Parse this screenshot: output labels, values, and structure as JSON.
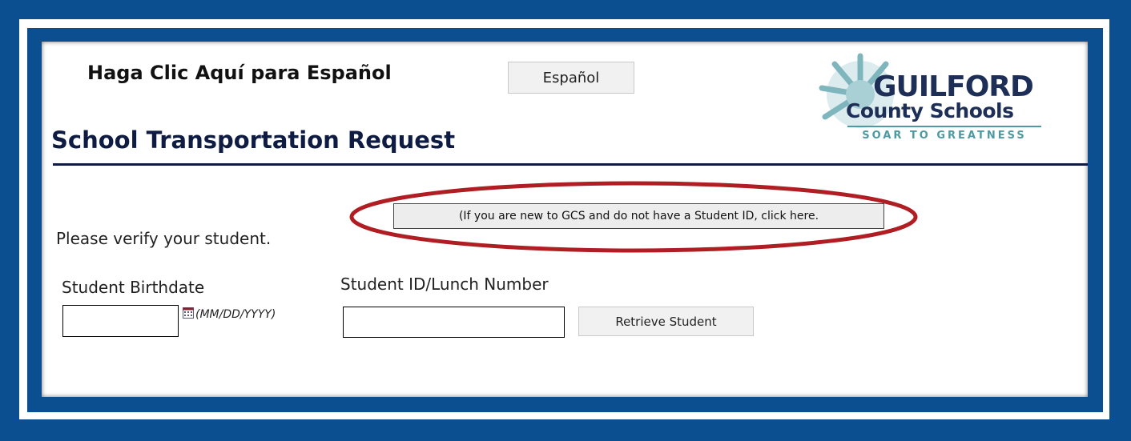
{
  "language": {
    "prompt": "Haga Clic Aquí para Español",
    "button_label": "Español"
  },
  "page": {
    "title": "School Transportation Request"
  },
  "logo": {
    "name": "GUILFORD",
    "subname": "County Schools",
    "tagline": "SOAR TO GREATNESS"
  },
  "new_student": {
    "button_label": "(If you are new to GCS and do not have a Student ID, click here."
  },
  "form": {
    "verify_text": "Please verify your student.",
    "birthdate_label": "Student Birthdate",
    "birthdate_value": "",
    "date_format_hint": "(MM/DD/YYYY)",
    "student_id_label": "Student ID/Lunch Number",
    "student_id_value": "",
    "retrieve_button": "Retrieve Student"
  },
  "colors": {
    "frame_blue": "#0b4f91",
    "title_navy": "#0e1c44",
    "highlight_red": "#b01e23",
    "logo_teal": "#4e9aa3"
  }
}
